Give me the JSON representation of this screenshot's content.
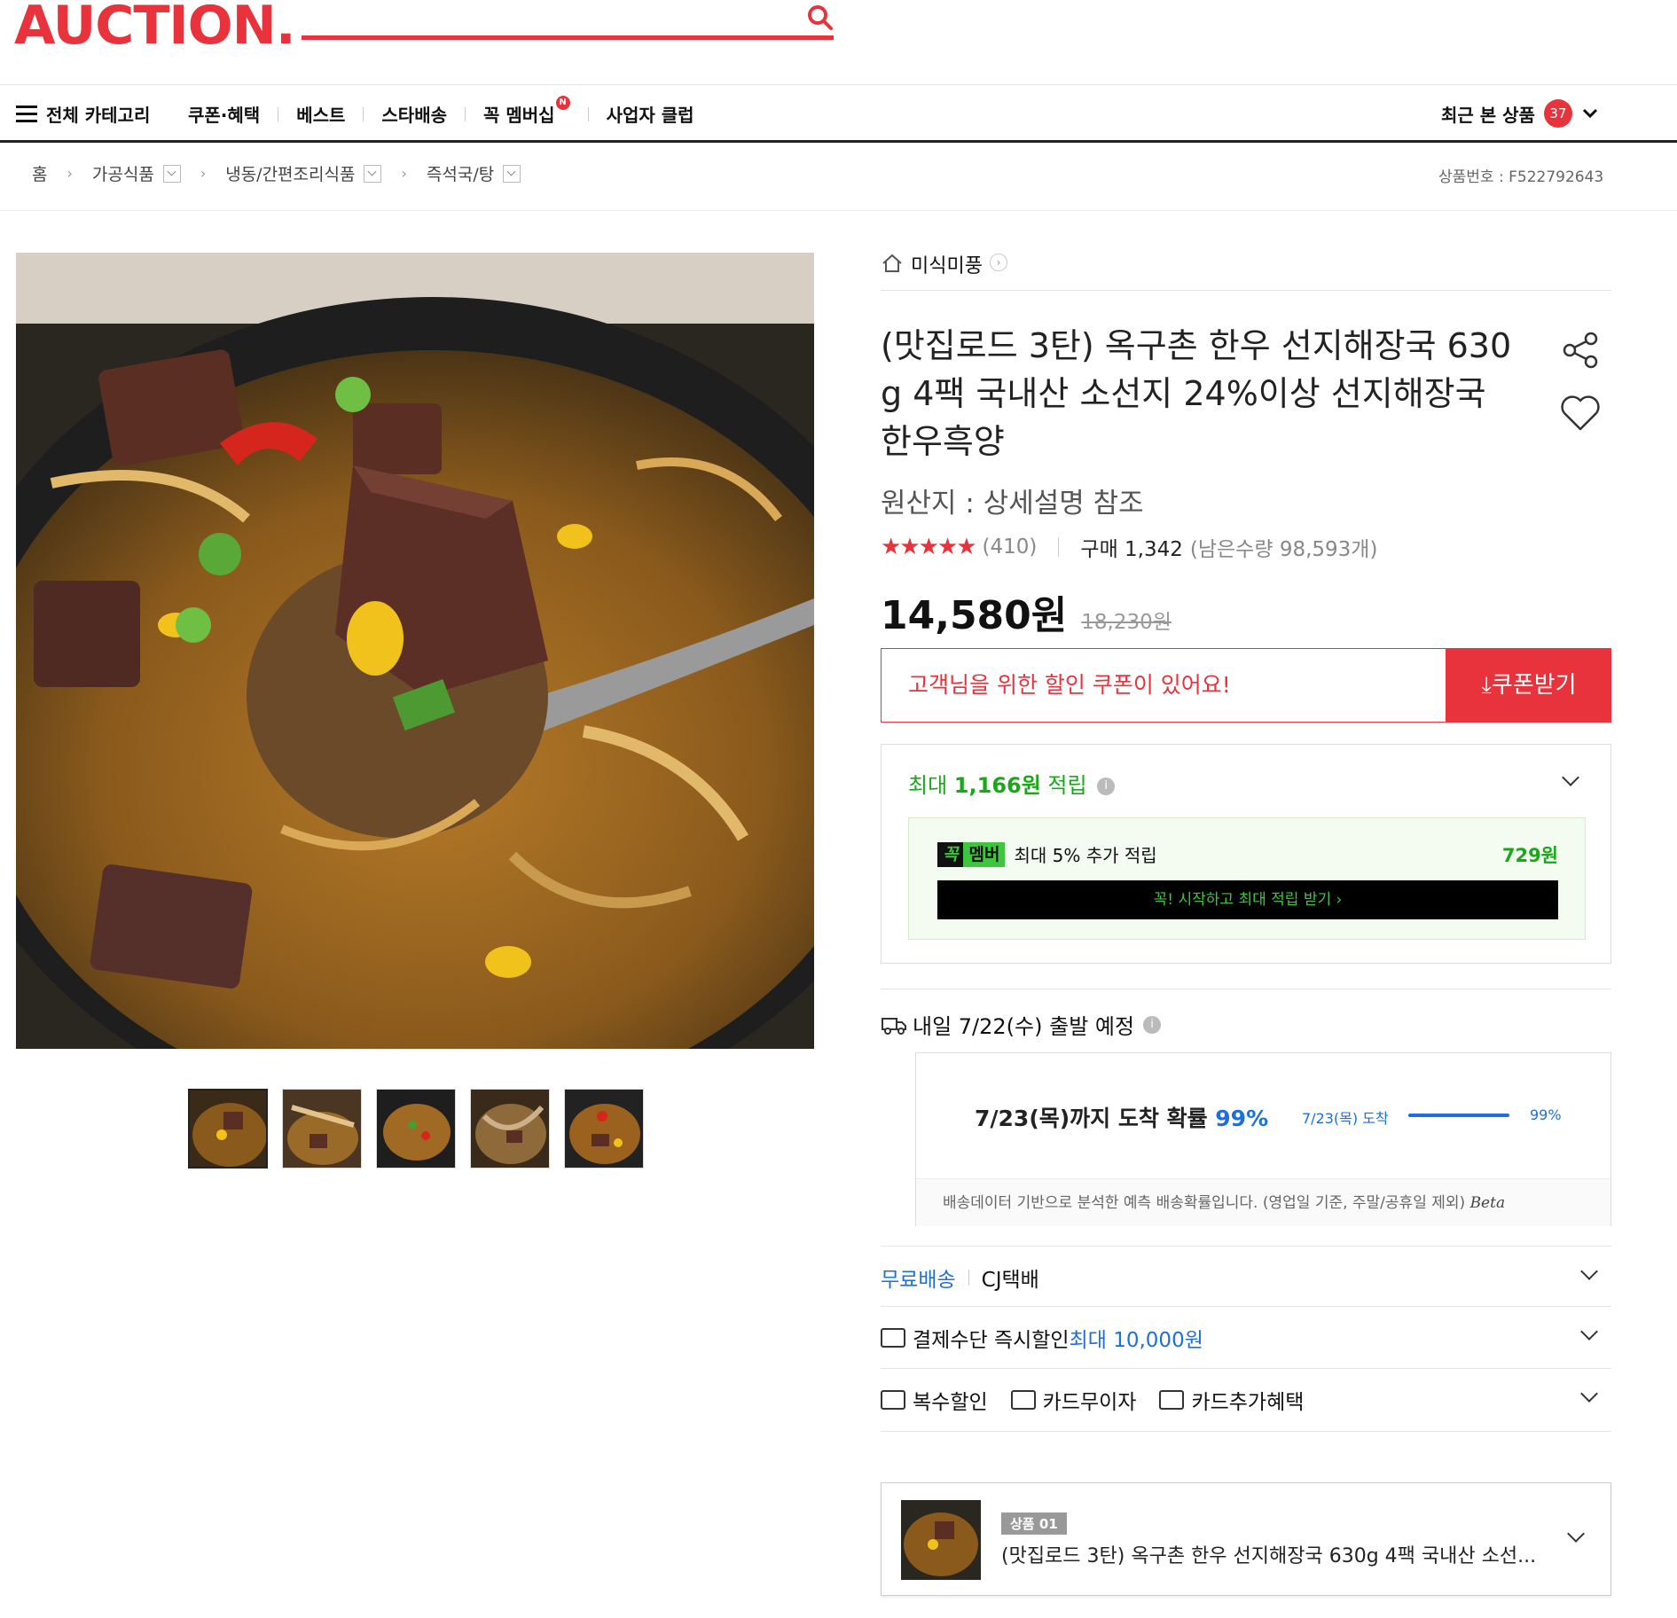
{
  "header": {
    "logo": "AUCTION.",
    "nav": {
      "all_categories": "전체 카테고리",
      "items": [
        "쿠폰·혜택",
        "베스트",
        "스타배송",
        "꼭 멤버십",
        "사업자 클럽"
      ],
      "membership_badge": "N",
      "recent_label": "최근 본 상품",
      "recent_count": "37"
    }
  },
  "breadcrumb": {
    "home": "홈",
    "items": [
      "가공식품",
      "냉동/간편조리식품",
      "즉석국/탕"
    ],
    "product_no": "상품번호 : F522792643"
  },
  "product": {
    "shop": "미식미풍",
    "title": "(맛집로드 3탄) 옥구촌 한우 선지해장국 630g 4팩 국내산 소선지 24%이상 선지해장국 한우흑양",
    "title_lines": [
      "(맛집로드 3탄) 옥구촌 한우 선지해장국 630",
      "g 4팩 국내산 소선지 24%이상 선지해장국",
      "한우흑양"
    ],
    "origin": "원산지 : 상세설명 참조",
    "stars": "★★★★★",
    "rating": 4.5,
    "review_count": "(410)",
    "purchase": "구매 1,342",
    "stock": "(남은수량 98,593개)",
    "price": "14,580원",
    "original_price": "18,230원",
    "thumbnails": 5
  },
  "coupon": {
    "message": "고객님을 위한 할인 쿠폰이 있어요!",
    "button": "쿠폰받기"
  },
  "points": {
    "prefix": "최대 ",
    "amount": "1,166원",
    "suffix": " 적립",
    "member_badge_1": "꼭",
    "member_badge_2": "멤버",
    "member_text": "최대 5% 추가 적립",
    "member_amount": "729원",
    "member_button": "꼭! 시작하고 최대 적립 받기 ›"
  },
  "shipping": {
    "departure": "내일 7/22(수) 출발 예정",
    "prob_main": "7/23(목)까지 도착 확률 ",
    "prob_pct_big": "99%",
    "prob_label": "7/23(목) 도착",
    "prob_pct": "99%",
    "prob_value": 0.99,
    "footnote": "배송데이터 기반으로 분석한 예측 배송확률입니다. (영업일 기준, 주말/공휴일 제외)",
    "beta": "Beta"
  },
  "rows": {
    "free_ship": "무료배송",
    "carrier": "CJ택배",
    "pay_discount": "결제수단 즉시할인 ",
    "pay_discount_amt": "최대 10,000원",
    "multi": "복수할인",
    "card_interest": "카드무이자",
    "card_benefit": "카드추가혜택"
  },
  "option": {
    "tag": "상품 01",
    "name": "(맛집로드 3탄) 옥구촌 한우 선지해장국 630g 4팩 국내산 소선..."
  },
  "colors": {
    "accent": "#e8323c",
    "green": "#1aa81a",
    "blue": "#1e6fd9"
  }
}
